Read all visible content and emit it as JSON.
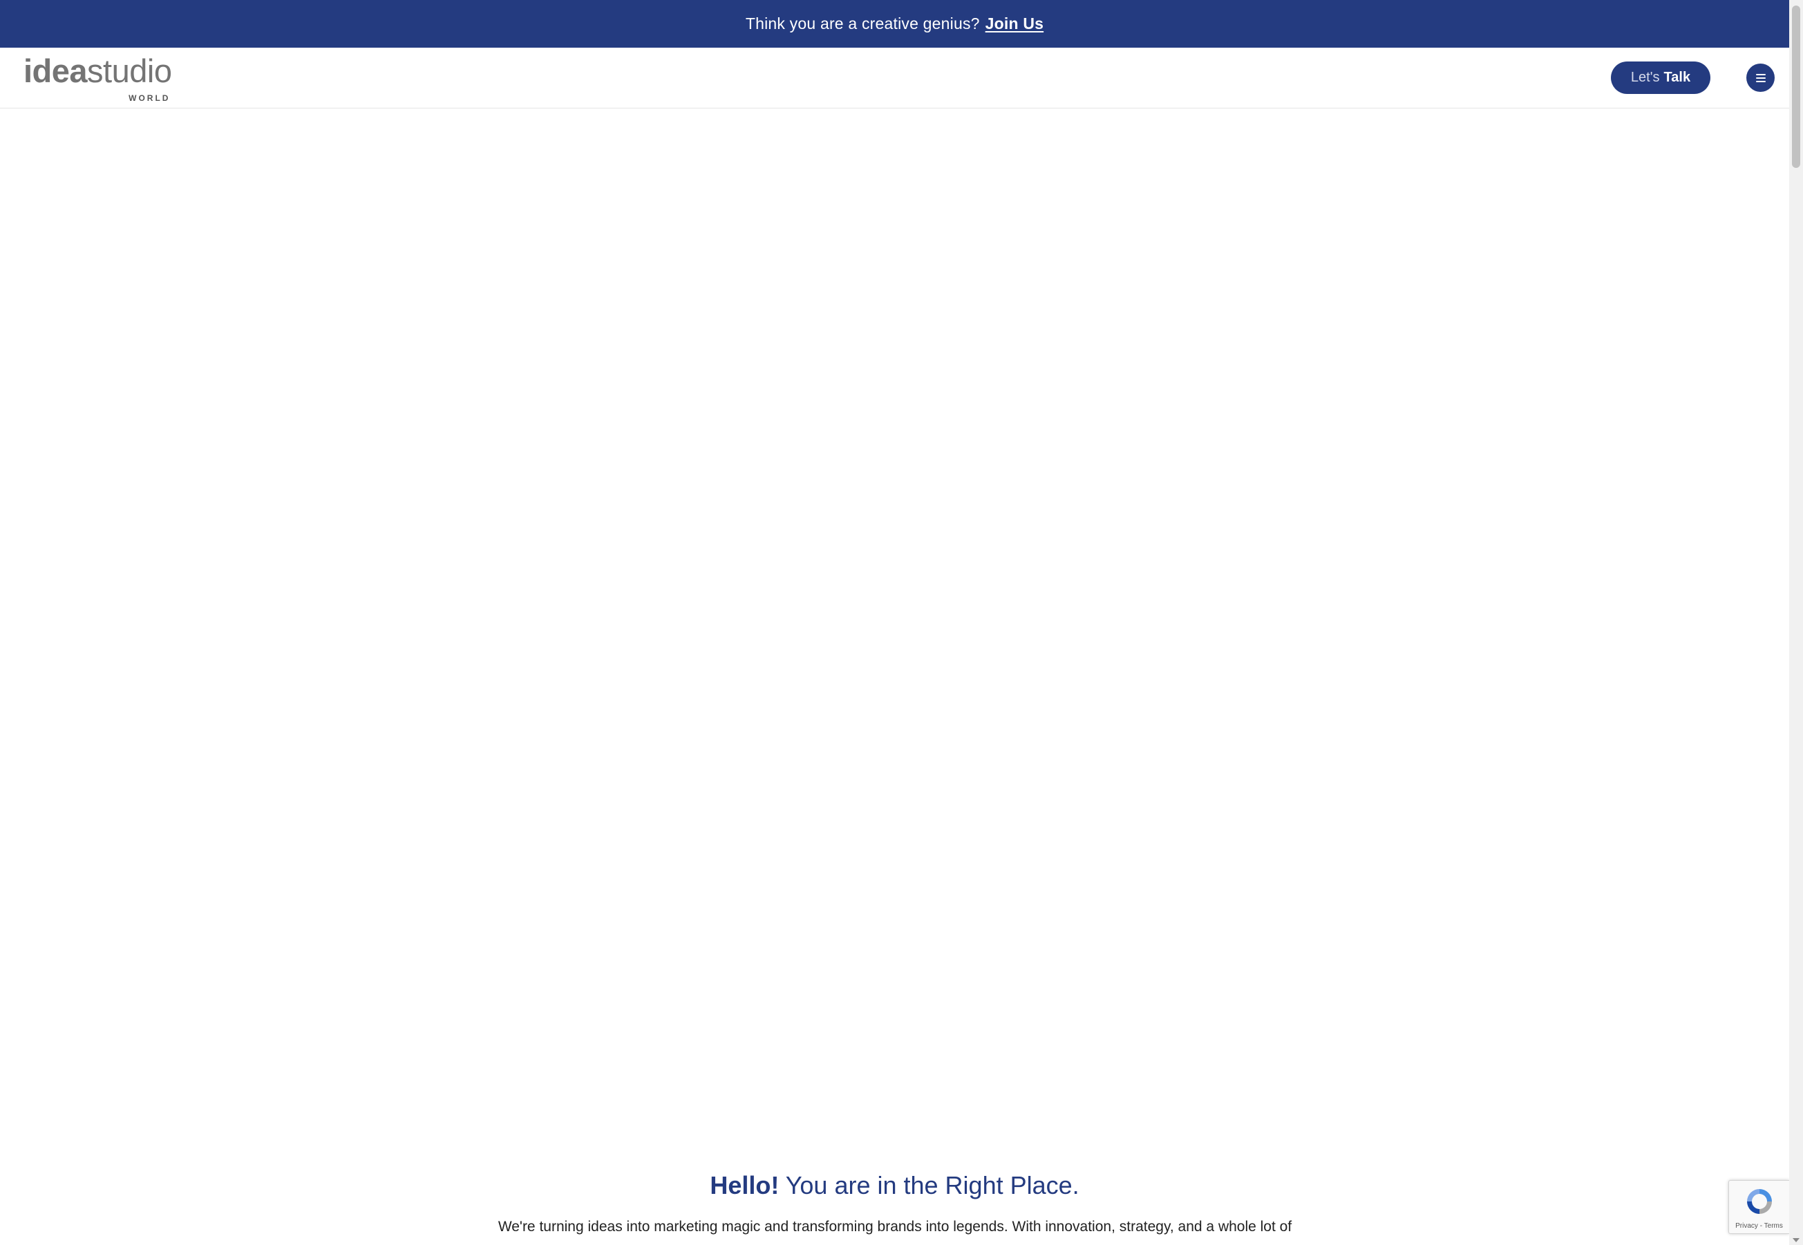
{
  "announcement": {
    "text": "Think you are a creative genius?",
    "link": "Join Us"
  },
  "header": {
    "logo": {
      "bold": "idea",
      "light": "studio",
      "sub": "WORLD"
    },
    "cta": {
      "light": "Let's",
      "bold": "Talk"
    },
    "menu_icon": "hamburger-icon"
  },
  "hero": {
    "title_bold": "Hello!",
    "title_rest": " You are in the Right Place.",
    "body": "We're turning ideas into marketing magic and transforming brands into legends. With innovation, strategy, and a whole lot of"
  },
  "recaptcha": {
    "icon": "recaptcha-icon",
    "links": "Privacy - Terms"
  },
  "colors": {
    "brand": "#243b80",
    "logo_gray": "#747474"
  }
}
